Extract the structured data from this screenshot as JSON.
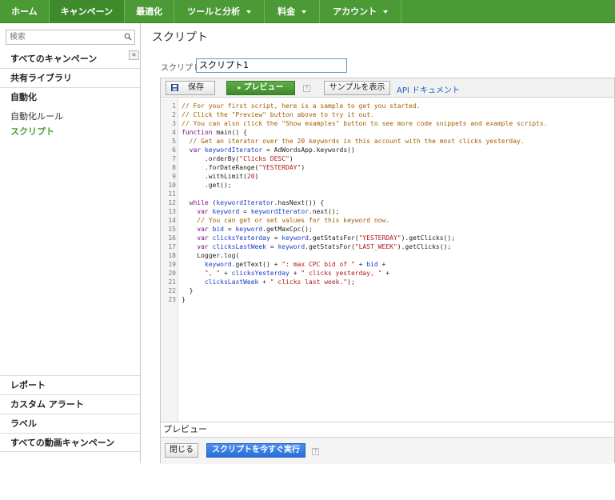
{
  "nav": {
    "tabs": [
      {
        "label": "ホーム",
        "caret": false
      },
      {
        "label": "キャンペーン",
        "caret": false,
        "active": true
      },
      {
        "label": "最適化",
        "caret": false
      },
      {
        "label": "ツールと分析",
        "caret": true
      },
      {
        "label": "料金",
        "caret": true
      },
      {
        "label": "アカウント",
        "caret": true
      }
    ],
    "colors": {
      "bar": "#4c9a35",
      "active": "#3f8a2b"
    }
  },
  "sidebar": {
    "search_placeholder": "検索",
    "collapse_glyph": "«",
    "items": [
      {
        "label": "すべてのキャンペーン"
      },
      {
        "label": "共有ライブラリ"
      },
      {
        "label": "自動化"
      }
    ],
    "subitems": [
      {
        "label": "自動化ルール",
        "active": false
      },
      {
        "label": "スクリプト",
        "active": true
      }
    ],
    "bottom_items": [
      {
        "label": "レポート"
      },
      {
        "label": "カスタム アラート"
      },
      {
        "label": "ラベル"
      },
      {
        "label": "すべての動画キャンペーン"
      }
    ]
  },
  "main": {
    "title": "スクリプト",
    "name_label": "スクリプト:",
    "name_value": "スクリプト1",
    "toolbar": {
      "save_label": "保存",
      "preview_label": "プレビュー",
      "preview_prefix": "▸",
      "help_glyph": "?",
      "examples_label": "サンプルを表示",
      "docs_label": "API ドキュメント"
    },
    "line_numbers": [
      "1",
      "2",
      "3",
      "4",
      "5",
      "6",
      "7",
      "8",
      "9",
      "10",
      "11",
      "12",
      "13",
      "14",
      "15",
      "16",
      "17",
      "18",
      "19",
      "20",
      "21",
      "22",
      "23"
    ],
    "code_lines": [
      "// For your first script, here is a sample to get you started.",
      "// Click the \"Preview\" button above to try it out.",
      "// You can also click the \"Show examples\" button to see more code snippets and example scripts.",
      "function main() {",
      "  // Get an iterator over the 20 keywords in this account with the most clicks yesterday.",
      "  var keywordIterator = AdWordsApp.keywords()",
      "      .orderBy(\"Clicks DESC\")",
      "      .forDateRange(\"YESTERDAY\")",
      "      .withLimit(20)",
      "      .get();",
      "",
      "  while (keywordIterator.hasNext()) {",
      "    var keyword = keywordIterator.next();",
      "    // You can get or set values for this keyword now.",
      "    var bid = keyword.getMaxCpc();",
      "    var clicksYesterday = keyword.getStatsFor(\"YESTERDAY\").getClicks();",
      "    var clicksLastWeek = keyword.getStatsFor(\"LAST_WEEK\").getClicks();",
      "    Logger.log(",
      "      keyword.getText() + \": max CPC bid of \" + bid +",
      "      \", \" + clicksYesterday + \" clicks yesterday, \" +",
      "      clicksLastWeek + \" clicks last week.\");",
      "  }",
      "}"
    ],
    "preview_section_label": "プレビュー",
    "close_label": "閉じる",
    "run_label": "スクリプトを今すぐ実行"
  }
}
